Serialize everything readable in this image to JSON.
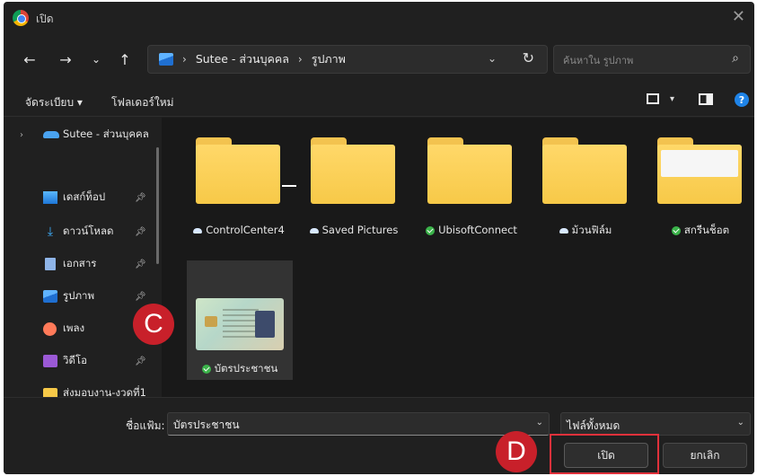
{
  "window": {
    "title": "เปิด"
  },
  "nav": {
    "breadcrumb": [
      "Sutee - ส่วนบุคคล",
      "รูปภาพ"
    ],
    "search_placeholder": "ค้นหาใน รูปภาพ"
  },
  "toolbar": {
    "organize": "จัดระเบียบ ▾",
    "new_folder": "โฟลเดอร์ใหม่"
  },
  "sidebar": {
    "items": [
      {
        "label": "Sutee - ส่วนบุคคล",
        "icon": "onedrive-icon"
      },
      {
        "label": "เดสก์ท็อป",
        "icon": "desktop-icon",
        "pinned": true
      },
      {
        "label": "ดาวน์โหลด",
        "icon": "download-icon",
        "pinned": true
      },
      {
        "label": "เอกสาร",
        "icon": "document-icon",
        "pinned": true
      },
      {
        "label": "รูปภาพ",
        "icon": "pictures-icon",
        "pinned": true
      },
      {
        "label": "เพลง",
        "icon": "music-icon",
        "pinned": true
      },
      {
        "label": "วิดีโอ",
        "icon": "video-icon",
        "pinned": true
      },
      {
        "label": "ส่งมอบงาน-งวดที่1",
        "icon": "folder-icon"
      }
    ]
  },
  "files": [
    {
      "name": "ControlCenter4",
      "status": "cloud"
    },
    {
      "name": "Saved Pictures",
      "status": "cloud"
    },
    {
      "name": "UbisoftConnect",
      "status": "synced"
    },
    {
      "name": "ม้วนฟิล์ม",
      "status": "cloud"
    },
    {
      "name": "สกรีนช็อต",
      "status": "synced"
    },
    {
      "name": "บัตรประชาชน",
      "status": "synced",
      "selected": true
    }
  ],
  "footer": {
    "filename_label": "ชื่อแฟ้ม:",
    "filename_value": "บัตรประชาชน",
    "filetype_value": "ไฟล์ทั้งหมด",
    "open_label": "เปิด",
    "cancel_label": "ยกเลิก"
  },
  "annotations": {
    "c": "C",
    "d": "D"
  },
  "colors": {
    "accent": "#c8202a",
    "folder": "#f7c948",
    "background": "#202020"
  }
}
